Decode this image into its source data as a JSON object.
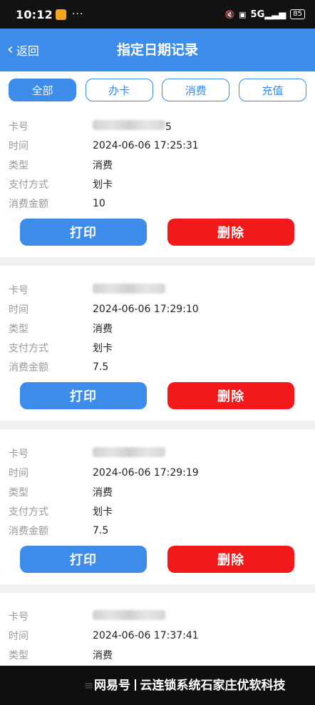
{
  "status_bar": {
    "time": "10:12",
    "dots": "···",
    "signal_text": "5G",
    "battery": "85"
  },
  "nav": {
    "back_label": "返回",
    "title": "指定日期记录"
  },
  "tabs": [
    {
      "label": "全部",
      "active": true
    },
    {
      "label": "办卡",
      "active": false
    },
    {
      "label": "消费",
      "active": false
    },
    {
      "label": "充值",
      "active": false
    }
  ],
  "labels": {
    "card_no": "卡号",
    "time": "时间",
    "type": "类型",
    "pay_method": "支付方式",
    "amount": "消费金额"
  },
  "buttons": {
    "print": "打印",
    "delete": "删除"
  },
  "records": [
    {
      "card_tail": "5",
      "time": "2024-06-06 17:25:31",
      "type": "消费",
      "pay_method": "划卡",
      "amount": "10"
    },
    {
      "card_tail": "",
      "time": "2024-06-06 17:29:10",
      "type": "消费",
      "pay_method": "划卡",
      "amount": "7.5"
    },
    {
      "card_tail": "",
      "time": "2024-06-06 17:29:19",
      "type": "消费",
      "pay_method": "划卡",
      "amount": "7.5"
    },
    {
      "card_tail": "",
      "time": "2024-06-06 17:37:41",
      "type": "消费",
      "pay_method": "",
      "amount": ""
    }
  ],
  "watermark": {
    "brand": "网易号",
    "text": "云连锁系统石家庄优软科技"
  },
  "colors": {
    "primary": "#3d8cea",
    "danger": "#f2191a"
  }
}
